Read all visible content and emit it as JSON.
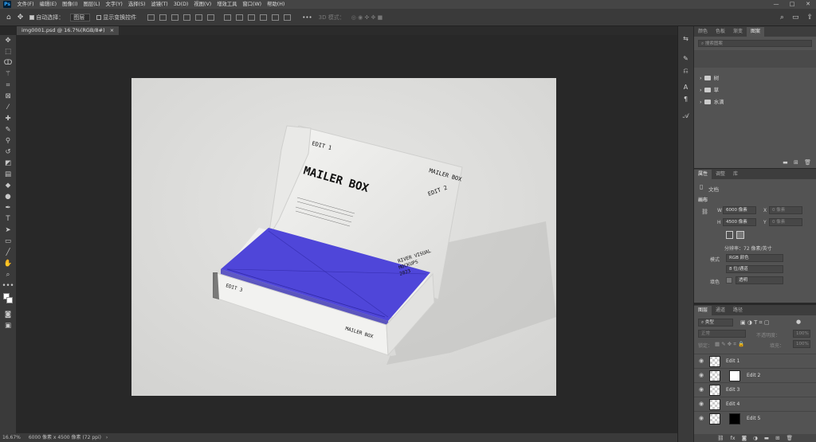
{
  "menubar": {
    "logo": "Ps",
    "items": [
      "文件(F)",
      "编辑(E)",
      "图像(I)",
      "图层(L)",
      "文字(Y)",
      "选择(S)",
      "滤镜(T)",
      "3D(D)",
      "视图(V)",
      "增效工具",
      "窗口(W)",
      "帮助(H)"
    ],
    "window_controls": [
      "—",
      "□",
      "✕"
    ]
  },
  "options": {
    "auto_select_label": "自动选择：",
    "auto_select_value": "图层",
    "show_transform_label": "显示变换控件",
    "more": "•••",
    "mode_label": "3D 模式："
  },
  "document": {
    "tab_title": "img0001.psd @ 16.7%(RGB/8#)",
    "tab_close": "×",
    "zoom": "16.67%",
    "doc_size": "6000 像素 x 4500 像素 (72 ppi)"
  },
  "mockup_text": {
    "lid_top": "EDIT 1",
    "lid_title": "MAILER BOX",
    "lid_corner": "MAILER BOX",
    "lid_edit2": "EDIT 2",
    "lid_credit_1": "RIVER VISUAL",
    "lid_credit_2": "MOCKUPS",
    "lid_credit_3": "2023",
    "front_edit3": "EDIT 3",
    "front_title": "MAILER BOX"
  },
  "libraries_panel": {
    "tabs": [
      "颜色",
      "色板",
      "渐变",
      "图案"
    ],
    "active_tab": "图案",
    "search_placeholder": "搜索图案",
    "items": [
      "树",
      "草",
      "水滴"
    ]
  },
  "properties_panel": {
    "tabs": [
      "属性",
      "调整",
      "库"
    ],
    "doc_label": "文档",
    "canvas_section": "画布",
    "w_label": "W",
    "w_value": "6000 像素",
    "h_label": "H",
    "h_value": "4500 像素",
    "x_label": "X",
    "x_value": "0 像素",
    "y_label": "Y",
    "y_value": "0 像素",
    "resolution": "分辨率：72 像素/英寸",
    "mode_label": "模式",
    "mode_value": "RGB 颜色",
    "depth_value": "8 位/通道",
    "fill_label": "填色",
    "fill_value": "透明"
  },
  "layers_panel": {
    "tabs": [
      "图层",
      "通道",
      "路径"
    ],
    "kind_filter": "类型",
    "blend_mode": "正常",
    "opacity_label": "不透明度：",
    "opacity_value": "100%",
    "lock_label": "锁定：",
    "fill_label": "填充：",
    "fill_value": "100%",
    "layers": [
      "Edit 1",
      "Edit 2",
      "Edit 3",
      "Edit 4",
      "Edit 5"
    ]
  },
  "colors": {
    "accent_purple": "#4f46d9",
    "box_white": "#ececea",
    "background_gray": "#dededc"
  }
}
